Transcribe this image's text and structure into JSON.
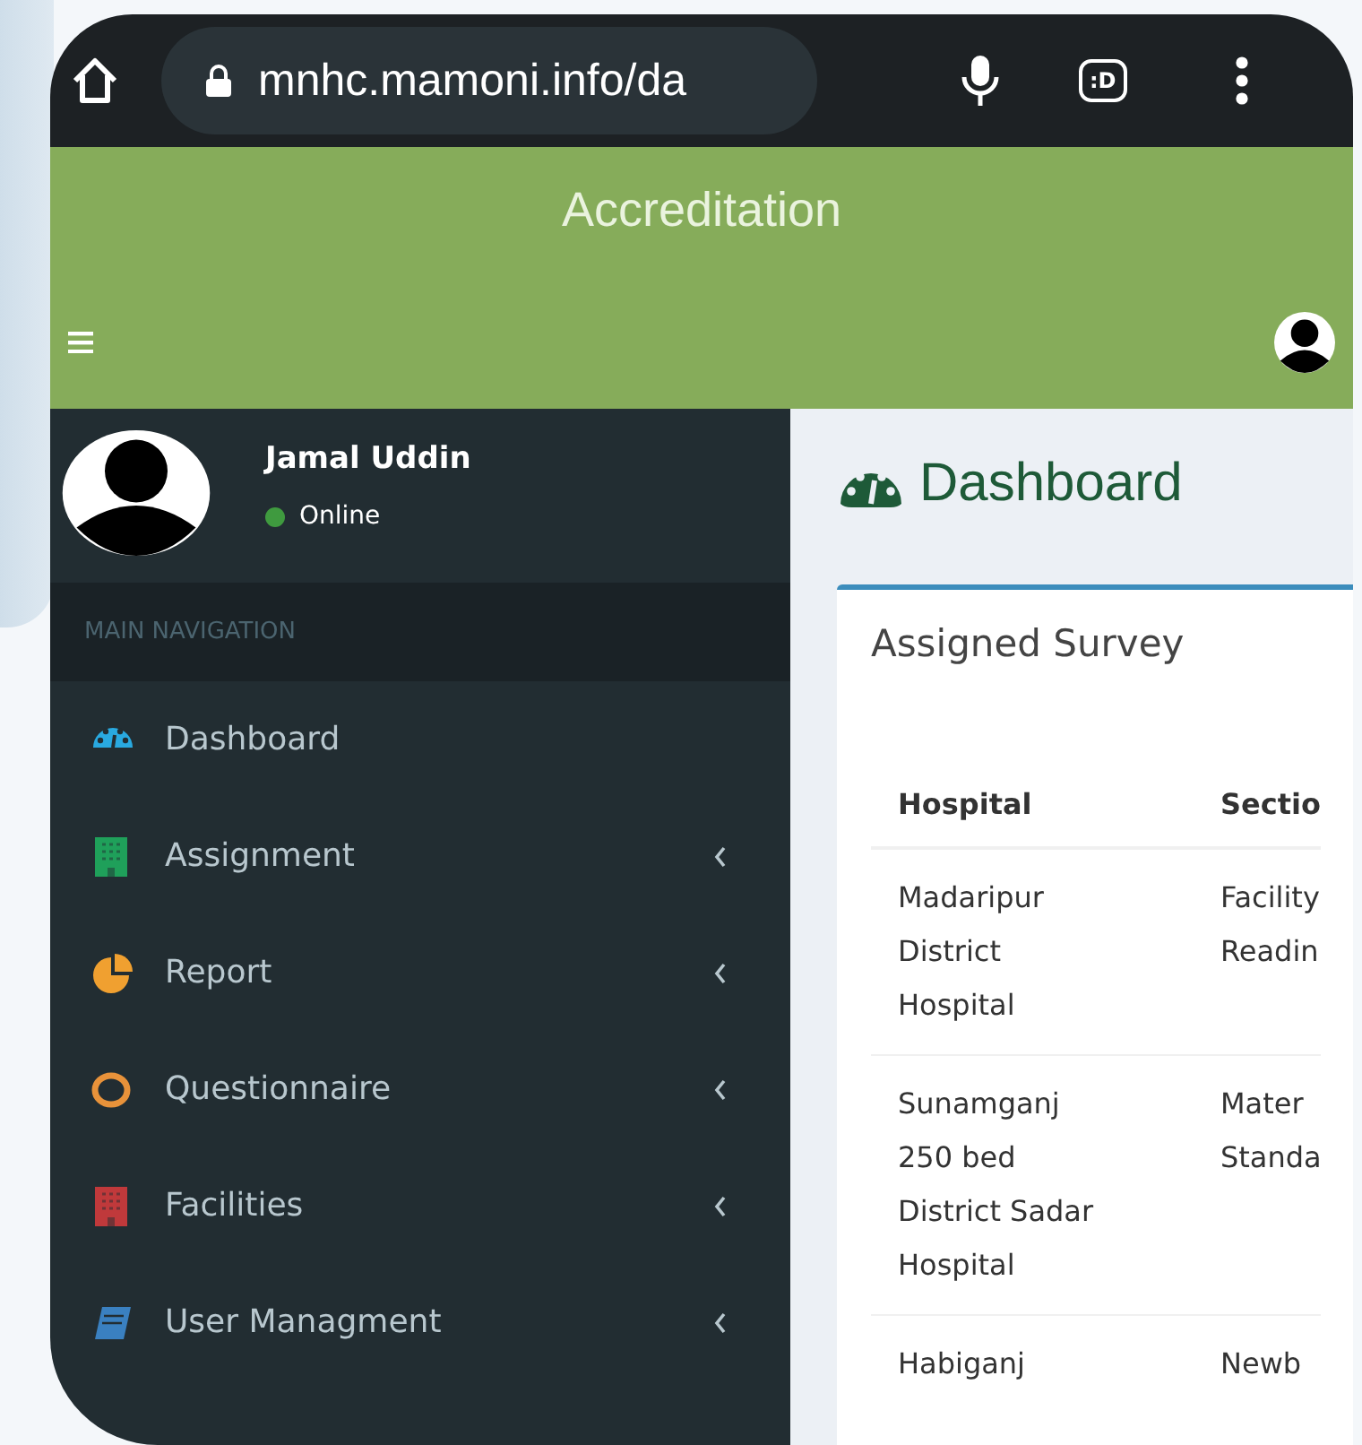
{
  "browser": {
    "url": "mnhc.mamoni.info/da",
    "tab_badge": ":D"
  },
  "header": {
    "title": "Accreditation"
  },
  "user": {
    "name": "Jamal Uddin",
    "status": "Online",
    "online": true
  },
  "sidebar": {
    "section_label": "MAIN NAVIGATION",
    "items": [
      {
        "label": "Dashboard",
        "kind": "gauge",
        "color": "#29a9e0",
        "has_submenu": false,
        "selected": false
      },
      {
        "label": "Assignment",
        "kind": "grid",
        "color": "#1fa05a",
        "has_submenu": true,
        "selected": false
      },
      {
        "label": "Report",
        "kind": "pie",
        "color": "#f0a030",
        "has_submenu": true,
        "selected": false
      },
      {
        "label": "Questionnaire",
        "kind": "ring",
        "color": "#e8923a",
        "has_submenu": true,
        "selected": false
      },
      {
        "label": "Facilities",
        "kind": "grid",
        "color": "#c0393b",
        "has_submenu": true,
        "selected": false
      },
      {
        "label": "User Managment",
        "kind": "book",
        "color": "#3a80c0",
        "has_submenu": true,
        "selected": false
      }
    ]
  },
  "page": {
    "title": "Dashboard"
  },
  "survey": {
    "title": "Assigned Survey",
    "columns": [
      "Hospital",
      "Sectio"
    ],
    "rows": [
      [
        "Madaripur\nDistrict\nHospital",
        "Facility\nReadin"
      ],
      [
        "Sunamganj\n250 bed\nDistrict Sadar\nHospital",
        "Mater\nStanda"
      ],
      [
        "Habiganj",
        "Newb"
      ]
    ]
  }
}
